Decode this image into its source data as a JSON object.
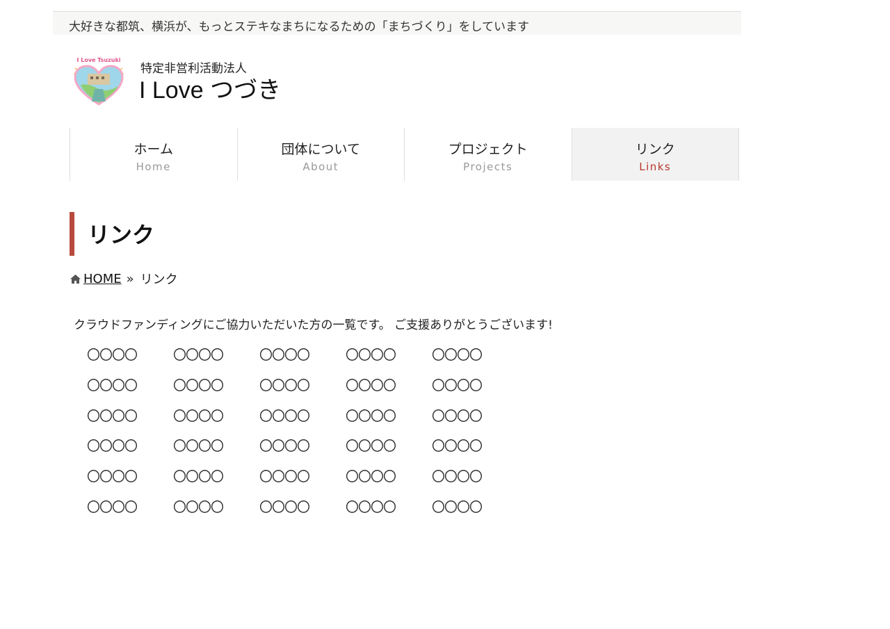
{
  "topbar": {
    "tagline": "大好きな都筑、横浜が、もっとステキなまちになるための「まちづくり」をしています"
  },
  "header": {
    "logo_text": "I Love Tsuzuki",
    "org_type": "特定非営利活動法人",
    "site_name": "I Love つづき"
  },
  "nav": {
    "items": [
      {
        "ja": "ホーム",
        "en": "Home"
      },
      {
        "ja": "団体について",
        "en": "About"
      },
      {
        "ja": "プロジェクト",
        "en": "Projects"
      },
      {
        "ja": "リンク",
        "en": "Links",
        "active": true
      }
    ]
  },
  "page": {
    "title": "リンク",
    "breadcrumb": {
      "home_label": "HOME",
      "separator": "»",
      "current": "リンク"
    },
    "intro": "クラウドファンディングにご協力いただいた方の一覧です。 ご支援ありがとうございます!",
    "supporters": [
      [
        "〇〇〇〇",
        "〇〇〇〇",
        "〇〇〇〇",
        "〇〇〇〇",
        "〇〇〇〇"
      ],
      [
        "〇〇〇〇",
        "〇〇〇〇",
        "〇〇〇〇",
        "〇〇〇〇",
        "〇〇〇〇"
      ],
      [
        "〇〇〇〇",
        "〇〇〇〇",
        "〇〇〇〇",
        "〇〇〇〇",
        "〇〇〇〇"
      ],
      [
        "〇〇〇〇",
        "〇〇〇〇",
        "〇〇〇〇",
        "〇〇〇〇",
        "〇〇〇〇"
      ],
      [
        "〇〇〇〇",
        "〇〇〇〇",
        "〇〇〇〇",
        "〇〇〇〇",
        "〇〇〇〇"
      ],
      [
        "〇〇〇〇",
        "〇〇〇〇",
        "〇〇〇〇",
        "〇〇〇〇",
        "〇〇〇〇"
      ]
    ]
  },
  "colors": {
    "accent": "#b84a3d",
    "active_nav_en": "#b8362b",
    "topbar_bg": "#f7f7f5"
  },
  "icons": {
    "breadcrumb_home": "home-icon",
    "logo": "heart-logo-icon"
  }
}
